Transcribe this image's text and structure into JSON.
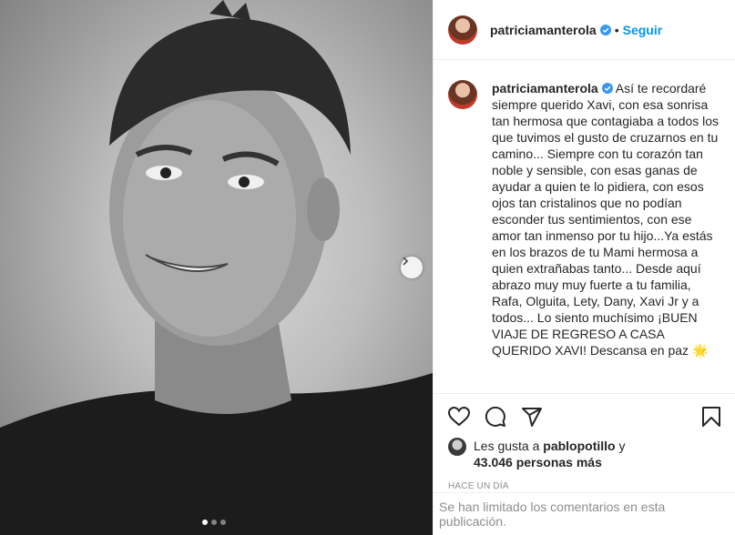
{
  "post": {
    "username": "patriciamanterola",
    "follow_label": "Seguir",
    "separator": "•",
    "caption": "Así te recordaré siempre querido Xavi, con esa sonrisa tan hermosa que contagiaba a todos los que tuvimos el gusto de cruzarnos en tu camino... Siempre con tu corazón tan noble y sensible, con esas ganas de ayudar a quien te lo pidiera, con esos ojos tan cristalinos que no podían esconder tus sentimientos, con ese amor tan inmenso por tu hijo...Ya estás en los brazos de tu Mami hermosa a quien extrañabas tanto... Desde aquí abrazo muy muy fuerte a tu familia, Rafa, Olguita, Lety, Dany, Xavi Jr y a todos... Lo siento muchísimo ¡BUEN VIAJE DE REGRESO A CASA QUERIDO XAVI! Descansa en paz",
    "caption_emoji": "🌟",
    "likes_prefix": "Les gusta a ",
    "likes_user": "pablopotillo",
    "likes_and": " y",
    "likes_count": "43.046 personas más",
    "timestamp": "HACE UN DÍA",
    "comments_limited": "Se han limitado los comentarios en esta publicación."
  },
  "icons": {
    "like": "heart-icon",
    "comment": "comment-icon",
    "share": "share-icon",
    "save": "bookmark-icon",
    "next": "chevron-right-icon",
    "verified": "verified-badge-icon"
  },
  "colors": {
    "link_blue": "#0095f6",
    "verified_blue": "#3897f0",
    "muted_gray": "#8e8e8e"
  },
  "carousel": {
    "total": 3,
    "current": 1
  }
}
